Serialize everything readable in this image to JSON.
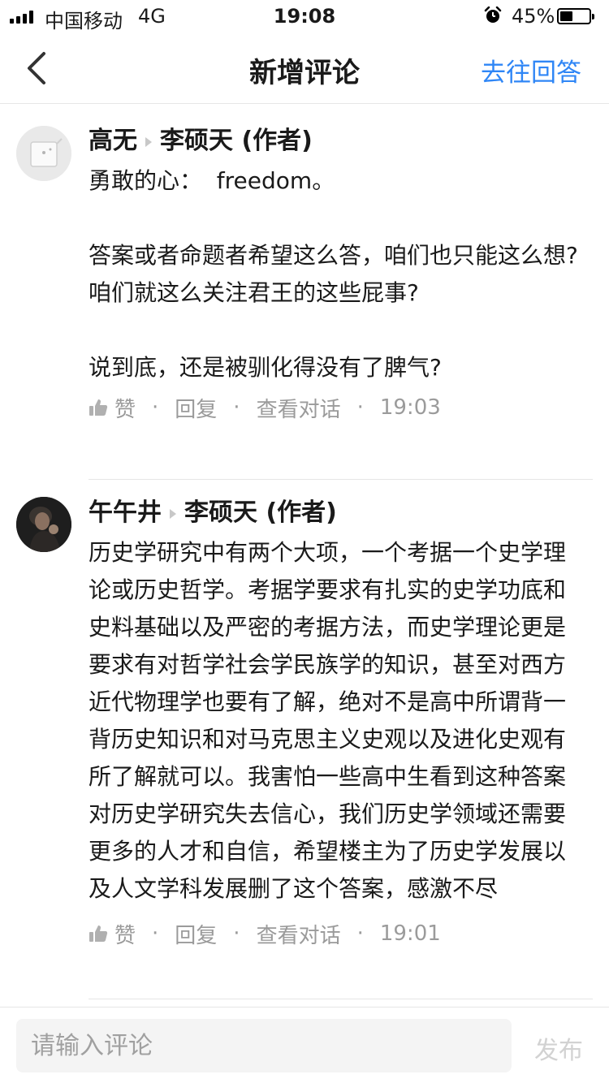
{
  "status_bar": {
    "carrier": "中国移动",
    "network": "4G",
    "time": "19:08",
    "battery_percent": "45%",
    "battery_level": 0.45
  },
  "nav": {
    "title": "新增评论",
    "action": "去往回答"
  },
  "comments": [
    {
      "author": "高无",
      "reply_to": "李硕天 (作者)",
      "text": "勇敢的心：  freedom。\n\n答案或者命题者希望这么答，咱们也只能这么想?\n咱们就这么关注君王的这些屁事?\n\n说到底，还是被驯化得没有了脾气?",
      "like_label": "赞",
      "reply_label": "回复",
      "view_conversation_label": "查看对话",
      "time": "19:03"
    },
    {
      "author": "午午井",
      "reply_to": "李硕天 (作者)",
      "text": "历史学研究中有两个大项，一个考据一个史学理论或历史哲学。考据学要求有扎实的史学功底和史料基础以及严密的考据方法，而史学理论更是要求有对哲学社会学民族学的知识，甚至对西方近代物理学也要有了解，绝对不是高中所谓背一背历史知识和对马克思主义史观以及进化史观有所了解就可以。我害怕一些高中生看到这种答案对历史学研究失去信心，我们历史学领域还需要更多的人才和自信，希望楼主为了历史学发展以及人文学科发展删了这个答案，感激不尽",
      "like_label": "赞",
      "reply_label": "回复",
      "view_conversation_label": "查看对话",
      "time": "19:01"
    }
  ],
  "separator": "·",
  "input_bar": {
    "placeholder": "请输入评论",
    "publish_label": "发布"
  }
}
